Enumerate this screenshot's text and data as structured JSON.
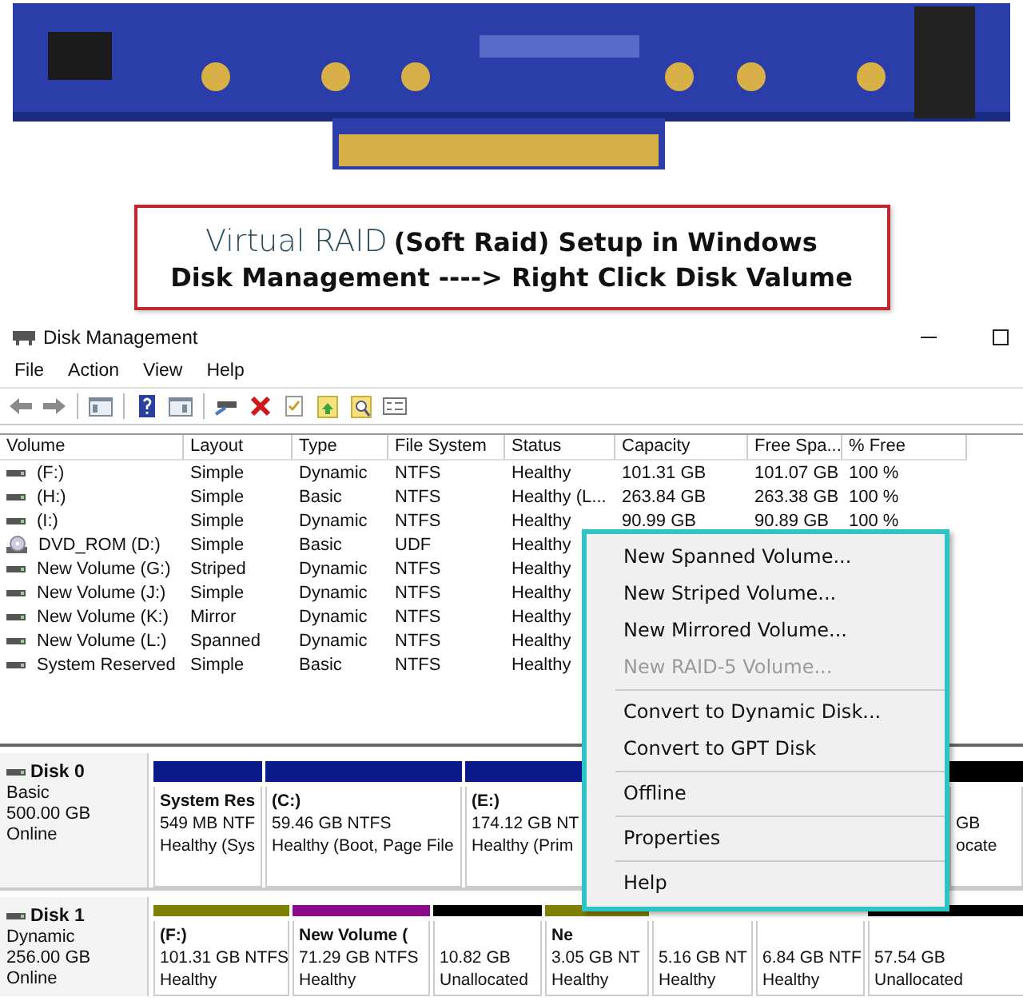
{
  "caption": {
    "lead": "Virtual RAID",
    "rest": "(Soft Raid) Setup in Windows",
    "line2": "Disk Management ----> Right Click Disk Valume"
  },
  "window": {
    "title": "Disk Management"
  },
  "menu_bar": [
    "File",
    "Action",
    "View",
    "Help"
  ],
  "volume_table": {
    "columns": [
      "Volume",
      "Layout",
      "Type",
      "File System",
      "Status",
      "Capacity",
      "Free Spa...",
      "% Free"
    ],
    "rows": [
      {
        "kind": "disk",
        "cells": [
          "(F:)",
          "Simple",
          "Dynamic",
          "NTFS",
          "Healthy",
          "101.31 GB",
          "101.07 GB",
          "100 %"
        ]
      },
      {
        "kind": "disk",
        "cells": [
          "(H:)",
          "Simple",
          "Basic",
          "NTFS",
          "Healthy (L...",
          "263.84 GB",
          "263.38 GB",
          "100 %"
        ]
      },
      {
        "kind": "disk",
        "cells": [
          "(I:)",
          "Simple",
          "Dynamic",
          "NTFS",
          "Healthy",
          "90.99 GB",
          "90.89 GB",
          "100 %"
        ]
      },
      {
        "kind": "optical",
        "cells": [
          "DVD_ROM (D:)",
          "Simple",
          "Basic",
          "UDF",
          "Healthy"
        ]
      },
      {
        "kind": "disk",
        "cells": [
          "New Volume (G:)",
          "Striped",
          "Dynamic",
          "NTFS",
          "Healthy"
        ]
      },
      {
        "kind": "disk",
        "cells": [
          "New Volume (J:)",
          "Simple",
          "Dynamic",
          "NTFS",
          "Healthy"
        ]
      },
      {
        "kind": "disk",
        "cells": [
          "New Volume (K:)",
          "Mirror",
          "Dynamic",
          "NTFS",
          "Healthy"
        ]
      },
      {
        "kind": "disk",
        "cells": [
          "New Volume (L:)",
          "Spanned",
          "Dynamic",
          "NTFS",
          "Healthy"
        ]
      },
      {
        "kind": "disk",
        "cells": [
          "System Reserved",
          "Simple",
          "Basic",
          "NTFS",
          "Healthy"
        ]
      }
    ]
  },
  "disks": [
    {
      "name": "Disk 0",
      "type": "Basic",
      "size": "500.00 GB",
      "state": "Online",
      "partitions": [
        {
          "color": "#0a1a8a",
          "name": "System Res",
          "size": "549 MB NTF",
          "status": "Healthy (Sys"
        },
        {
          "color": "#0a1a8a",
          "name": "(C:)",
          "size": "59.46 GB NTFS",
          "status": "Healthy (Boot, Page File"
        },
        {
          "color": "#0a1a8a",
          "name": "(E:)",
          "size": "174.12 GB NT",
          "status": "Healthy (Prim"
        },
        {
          "color": "#000000",
          "size": "GB",
          "status": "ocate"
        }
      ]
    },
    {
      "name": "Disk 1",
      "type": "Dynamic",
      "size": "256.00 GB",
      "state": "Online",
      "partitions": [
        {
          "color": "#7f7f00",
          "name": "(F:)",
          "size": "101.31 GB NTFS",
          "status": "Healthy"
        },
        {
          "color": "#8a0a8a",
          "name": "New Volume  (",
          "size": "71.29 GB NTFS",
          "status": "Healthy"
        },
        {
          "color": "#000000",
          "size": "10.82 GB",
          "status": "Unallocated"
        },
        {
          "color": "#7f7f00",
          "name": "Ne",
          "size": "3.05 GB NT",
          "status": "Healthy"
        },
        {
          "size": "5.16 GB NT",
          "status": "Healthy"
        },
        {
          "size": "6.84 GB NTF",
          "status": "Healthy"
        },
        {
          "color": "#000000",
          "size": "57.54 GB",
          "status": "Unallocated"
        }
      ]
    }
  ],
  "context_menu": {
    "groups": [
      [
        {
          "label": "New Spanned Volume...",
          "disabled": false
        },
        {
          "label": "New Striped Volume...",
          "disabled": false
        },
        {
          "label": "New Mirrored Volume...",
          "disabled": false
        },
        {
          "label": "New RAID-5 Volume...",
          "disabled": true
        }
      ],
      [
        {
          "label": "Convert to Dynamic Disk...",
          "disabled": false
        },
        {
          "label": "Convert to GPT Disk",
          "disabled": false
        }
      ],
      [
        {
          "label": "Offline",
          "disabled": false
        }
      ],
      [
        {
          "label": "Properties",
          "disabled": false
        }
      ],
      [
        {
          "label": "Help",
          "disabled": false
        }
      ]
    ]
  }
}
